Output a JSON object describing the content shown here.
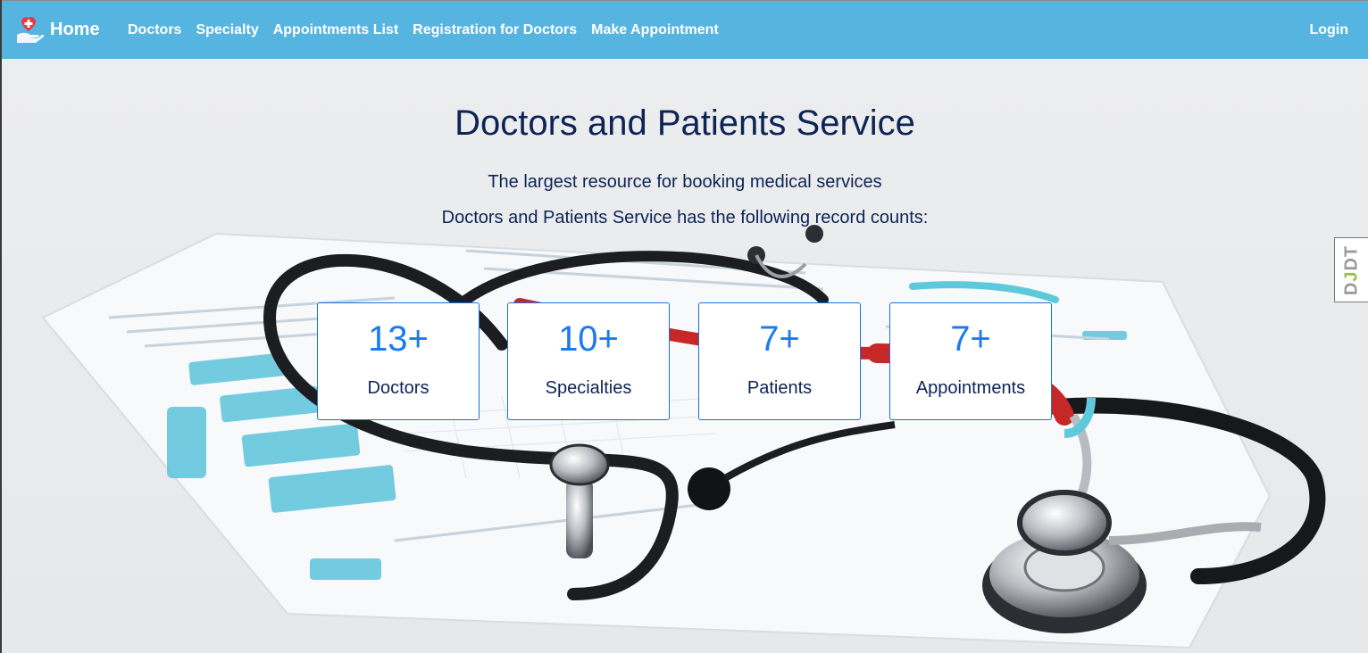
{
  "navbar": {
    "brand_label": "Home",
    "links": [
      {
        "label": "Doctors"
      },
      {
        "label": "Specialty"
      },
      {
        "label": "Appointments List"
      },
      {
        "label": "Registration for Doctors"
      },
      {
        "label": "Make Appointment"
      }
    ],
    "login_label": "Login",
    "background_color": "#56b4e0"
  },
  "hero": {
    "title": "Doctors and Patients Service",
    "subtitle": "The largest resource for booking medical services",
    "counts_intro": "Doctors and Patients Service has the following record counts:"
  },
  "stats": [
    {
      "value": "13+",
      "label": "Doctors"
    },
    {
      "value": "10+",
      "label": "Specialties"
    },
    {
      "value": "7+",
      "label": "Patients"
    },
    {
      "value": "7+",
      "label": "Appointments"
    }
  ],
  "debug_toolbar": {
    "label_d": "D",
    "label_j": "J",
    "label_dt": "DT"
  },
  "icons": {
    "brand_icon": "hand-holding-heart-icon"
  }
}
